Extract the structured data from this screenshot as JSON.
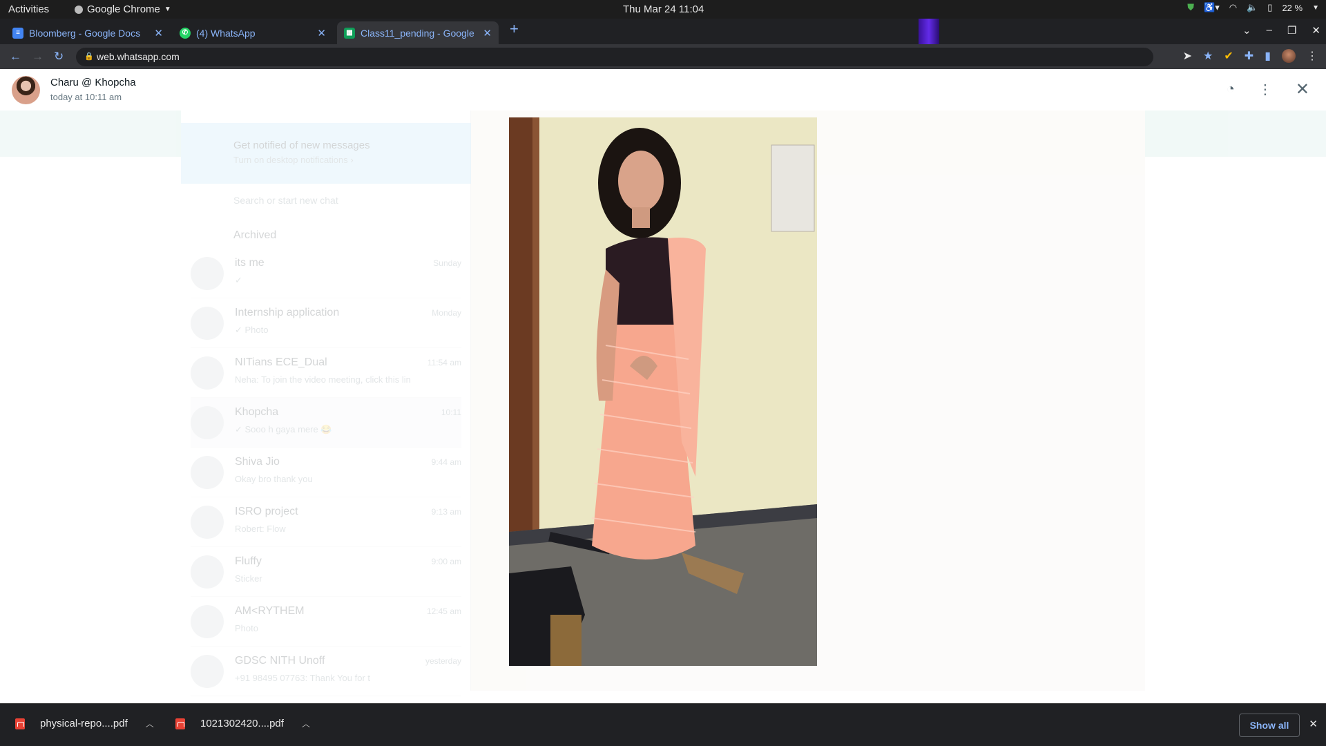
{
  "topbar": {
    "activities": "Activities",
    "app_name": "Google Chrome",
    "clock": "Thu Mar 24  11:04",
    "battery": "22 %"
  },
  "tabs": [
    {
      "label": "Bloomberg - Google Docs",
      "icon": "docs-icon",
      "color": "#4285f4"
    },
    {
      "label": "(4) WhatsApp",
      "icon": "whatsapp-icon",
      "color": "#25d366"
    },
    {
      "label": "Class11_pending - Google",
      "icon": "sheets-icon",
      "color": "#0f9d58"
    }
  ],
  "toolbar": {
    "url": "web.whatsapp.com"
  },
  "media_viewer": {
    "sender": "Charu @ Khopcha",
    "timestamp": "today at 10:11 am",
    "actions": [
      "clock-icon",
      "more-icon",
      "close-icon"
    ]
  },
  "background_chats": {
    "notification_title": "Get notified of new messages",
    "notification_sub": "Turn on desktop notifications ›",
    "search_placeholder": "Search or start new chat",
    "archived": "Archived",
    "chats": [
      {
        "name": "its me",
        "snippet": "✓",
        "time": "Sunday"
      },
      {
        "name": "Internship application",
        "snippet": "✓ Photo",
        "time": "Monday"
      },
      {
        "name": "NITians ECE_Dual",
        "snippet": "Neha: To join the video meeting, click this lin",
        "time": "11:54 am"
      },
      {
        "name": "Khopcha",
        "snippet": "✓ Sooo h gaya mere 😂",
        "time": "10:11"
      },
      {
        "name": "Shiva Jio",
        "snippet": "Okay bro thank you",
        "time": "9:44 am"
      },
      {
        "name": "ISRO project",
        "snippet": "Robert: Flow",
        "time": "9:13 am"
      },
      {
        "name": "Fluffy",
        "snippet": "Sticker",
        "time": "9:00 am"
      },
      {
        "name": "AM<RYTHEM",
        "snippet": "Photo",
        "time": "12:45 am"
      },
      {
        "name": "GDSC NITH Unoff",
        "snippet": "+91 98495 07763: Thank You for t",
        "time": "yesterday"
      }
    ]
  },
  "downloads": [
    {
      "name": "physical-repo....pdf"
    },
    {
      "name": "1021302420....pdf"
    }
  ],
  "shelf": {
    "show_all": "Show all"
  }
}
